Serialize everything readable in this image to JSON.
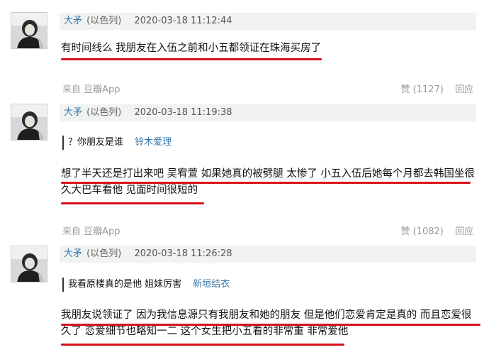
{
  "comments": [
    {
      "author": "大矛",
      "group": "(以色列)",
      "time": "2020-03-18 11:12:44",
      "lines": [
        "有时间线么 我朋友在入伍之前和小五都领证在珠海买房了"
      ],
      "footer": {
        "from": "来自 豆瓣App",
        "likes": "赞 (1127)",
        "reply": "回应"
      }
    },
    {
      "author": "大矛",
      "group": "(以色列)",
      "time": "2020-03-18 11:19:38",
      "quote": {
        "text": "？你朋友是谁",
        "author": "铃木爱理"
      },
      "lines": [
        "想了半天还是打出来吧 吴宥萱 如果她真的被劈腿 太惨了 小五入伍后她每个月都去韩国坐很",
        "久大巴车看他 见面时间很短的"
      ],
      "footer": {
        "from": "来自 豆瓣App",
        "likes": "赞 (1082)",
        "reply": "回应"
      }
    },
    {
      "author": "大矛",
      "group": "(以色列)",
      "time": "2020-03-18 11:26:28",
      "quote": {
        "text": "我看原楼真的是他 姐妹厉害",
        "author": "新垣结衣"
      },
      "lines": [
        "我朋友说领证了 因为我信息源只有我朋友和她的朋友 但是他们恋爱肯定是真的 而且恋爱很",
        "久了 恋爱细节也略知一二 这个女生把小五看的非常重 非常爱他"
      ]
    }
  ]
}
